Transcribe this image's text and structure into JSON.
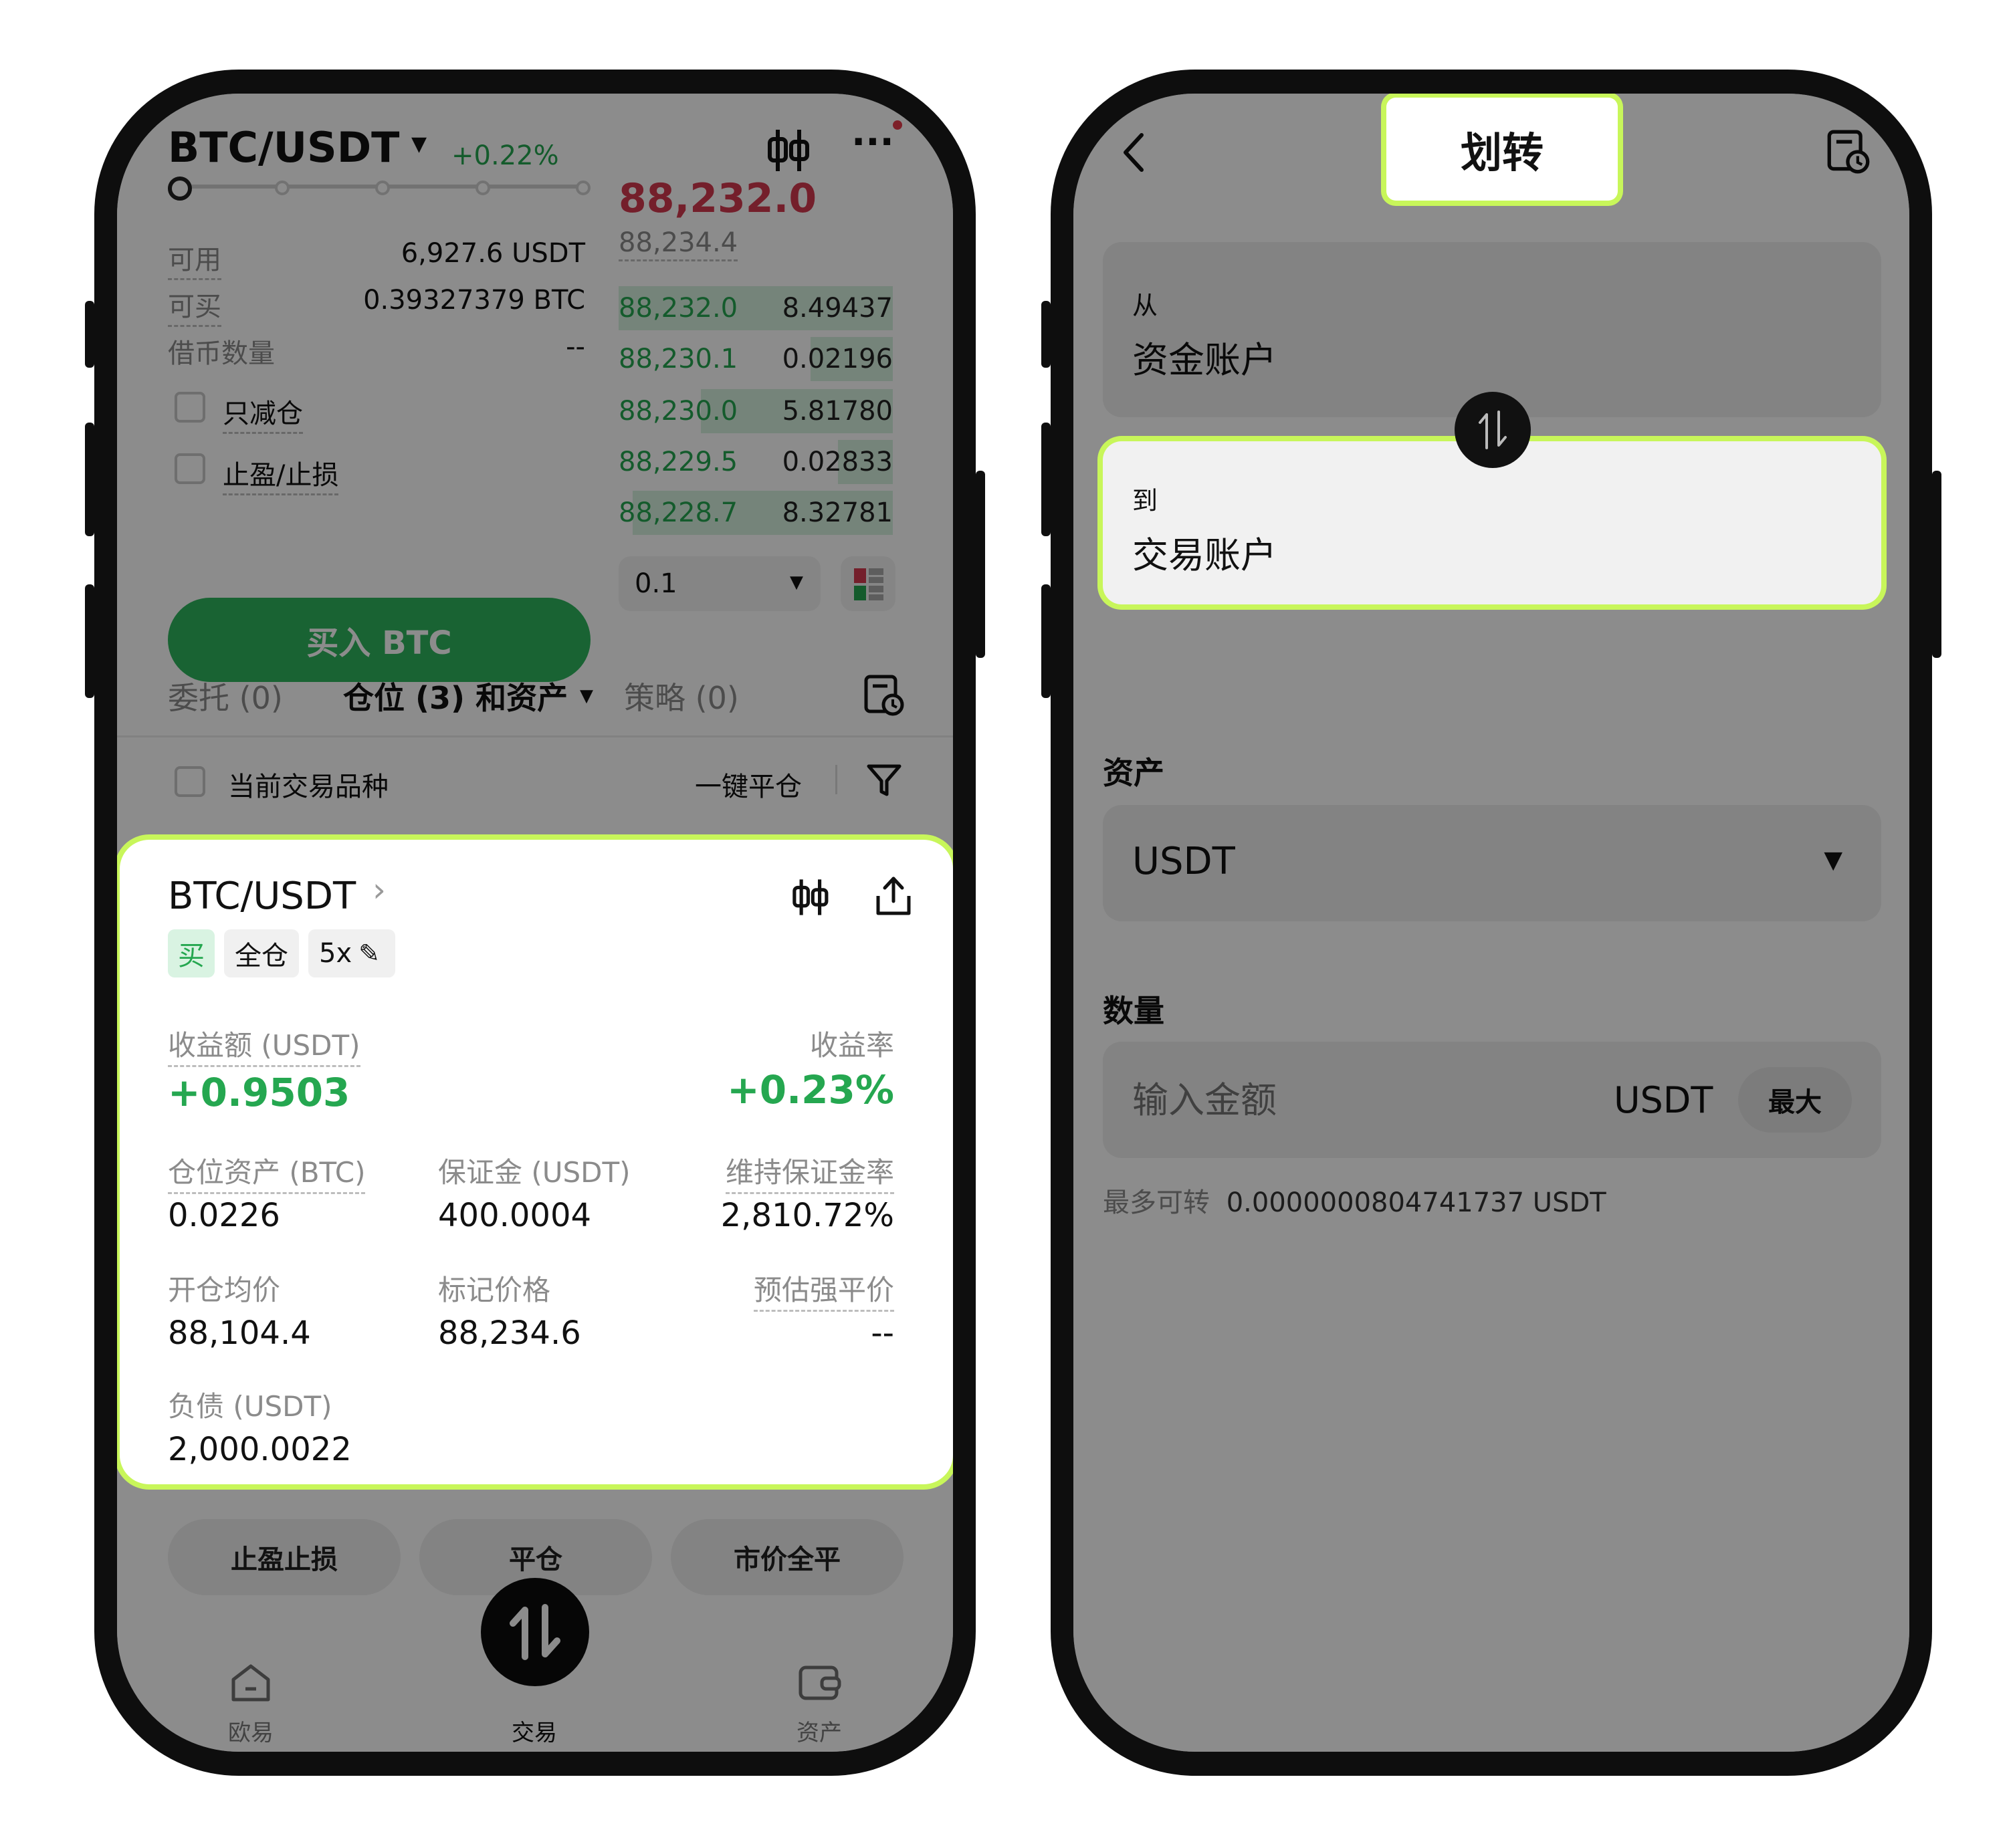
{
  "left": {
    "header": {
      "pair": "BTC/USDT",
      "change": "+0.22%"
    },
    "price": {
      "last": "88,232.0",
      "mark": "88,234.4"
    },
    "info": [
      {
        "label": "可用",
        "value": "6,927.6 USDT"
      },
      {
        "label": "可买",
        "value": "0.39327379 BTC"
      },
      {
        "label": "借币数量",
        "value": "--"
      }
    ],
    "options": {
      "reduce_only": "只减仓",
      "tp_sl": "止盈/止损"
    },
    "buy_button": "买入 BTC",
    "orderbook": [
      {
        "price": "88,232.0",
        "qty": "8.49437",
        "depth": 1.0
      },
      {
        "price": "88,230.1",
        "qty": "0.02196",
        "depth": 0.3
      },
      {
        "price": "88,230.0",
        "qty": "5.81780",
        "depth": 0.7
      },
      {
        "price": "88,229.5",
        "qty": "0.02833",
        "depth": 0.2
      },
      {
        "price": "88,228.7",
        "qty": "8.32781",
        "depth": 0.95
      }
    ],
    "depth_select": "0.1",
    "tabs": {
      "orders": "委托 (0)",
      "positions": "仓位 (3) 和资产",
      "strategies": "策略 (0)"
    },
    "filter": {
      "current_symbol": "当前交易品种",
      "close_all": "一键平仓"
    },
    "position": {
      "pair": "BTC/USDT",
      "tags": {
        "side": "买",
        "margin_mode": "全仓",
        "leverage": "5x"
      },
      "pnl_label": "收益额 (USDT)",
      "pnl_value": "+0.9503",
      "roi_label": "收益率",
      "roi_value": "+0.23%",
      "asset_label": "仓位资产 (BTC)",
      "asset_value": "0.0226",
      "margin_label": "保证金 (USDT)",
      "margin_value": "400.0004",
      "mmr_label": "维持保证金率",
      "mmr_value": "2,810.72%",
      "entry_label": "开仓均价",
      "entry_value": "88,104.4",
      "markp_label": "标记价格",
      "markp_value": "88,234.6",
      "liq_label": "预估强平价",
      "liq_value": "--",
      "debt_label": "负债 (USDT)",
      "debt_value": "2,000.0022"
    },
    "actions": {
      "tpsl": "止盈止损",
      "close": "平仓",
      "market_close": "市价全平"
    },
    "nav": {
      "home": "欧易",
      "trade": "交易",
      "assets": "资产"
    }
  },
  "right": {
    "title": "划转",
    "from_label": "从",
    "from_value": "资金账户",
    "to_label": "到",
    "to_value": "交易账户",
    "asset_label": "资产",
    "asset_value": "USDT",
    "amount_label": "数量",
    "amount_placeholder": "输入金额",
    "amount_unit": "USDT",
    "max_button": "最大",
    "max_transfer_label": "最多可转",
    "max_transfer_value": "0.0000000804741737 USDT"
  }
}
